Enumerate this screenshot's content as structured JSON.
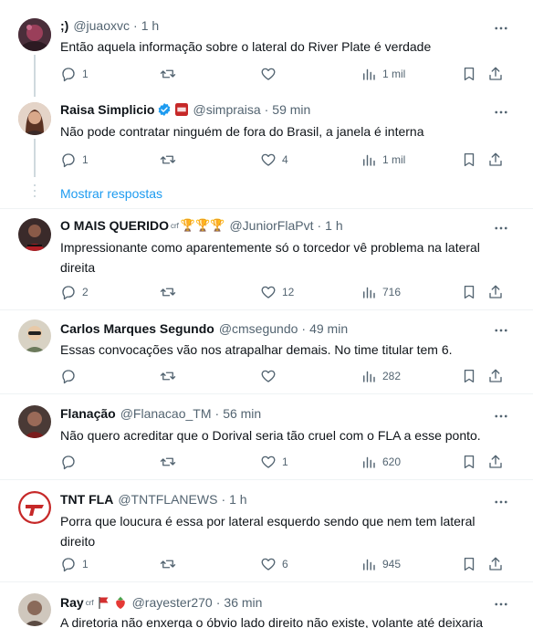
{
  "tweets": [
    {
      "name": ";)",
      "handle": "@juaoxvc",
      "time": "1 h",
      "text": "Então aquela informação sobre o lateral do River Plate é verdade",
      "replies": "1",
      "retweets": "",
      "likes": "",
      "views": "1 mil"
    },
    {
      "name": "Raisa Simplicio",
      "handle": "@simpraisa",
      "time": "59 min",
      "text": "Não pode contratar ninguém de fora do Brasil, a janela é interna",
      "replies": "1",
      "retweets": "",
      "likes": "4",
      "views": "1 mil"
    },
    {
      "name": "O MAIS QUERIDO",
      "handle": "@JuniorFlaPvt",
      "time": "1 h",
      "text": "Impressionante como aparentemente só o torcedor vê problema na lateral direita",
      "replies": "2",
      "retweets": "",
      "likes": "12",
      "views": "716"
    },
    {
      "name": "Carlos Marques Segundo",
      "handle": "@cmsegundo",
      "time": "49 min",
      "text": "Essas convocações vão nos atrapalhar demais. No time titular tem 6.",
      "replies": "",
      "retweets": "",
      "likes": "",
      "views": "282"
    },
    {
      "name": "Flanação",
      "handle": "@Flanacao_TM",
      "time": "56 min",
      "text": "Não quero acreditar que o Dorival seria tão cruel com o FLA a esse ponto.",
      "replies": "",
      "retweets": "",
      "likes": "1",
      "views": "620"
    },
    {
      "name": "TNT FLA",
      "handle": "@TNTFLANEWS",
      "time": "1 h",
      "text": "Porra que loucura é essa por lateral esquerdo sendo que nem tem lateral direito",
      "replies": "1",
      "retweets": "",
      "likes": "6",
      "views": "945"
    },
    {
      "name": "Ray",
      "handle": "@rayester270",
      "time": "36 min",
      "text": "A diretoria não enxerga o óbvio lado direito não existe, volante até deixaria",
      "replies": "",
      "retweets": "",
      "likes": "",
      "views": ""
    }
  ],
  "show_replies": "Mostrar respostas",
  "badges": {
    "crf": "crf",
    "trophies": "🏆🏆🏆"
  },
  "icons": {
    "reply": "reply-icon",
    "retweet": "retweet-icon",
    "like": "heart-icon",
    "views": "views-icon",
    "bookmark": "bookmark-icon",
    "share": "share-icon",
    "more": "more-icon",
    "verified": "verified-icon"
  },
  "colors": {
    "accent": "#1d9bf0",
    "muted": "#536471",
    "text": "#0f1419",
    "divider": "#eff3f4"
  }
}
